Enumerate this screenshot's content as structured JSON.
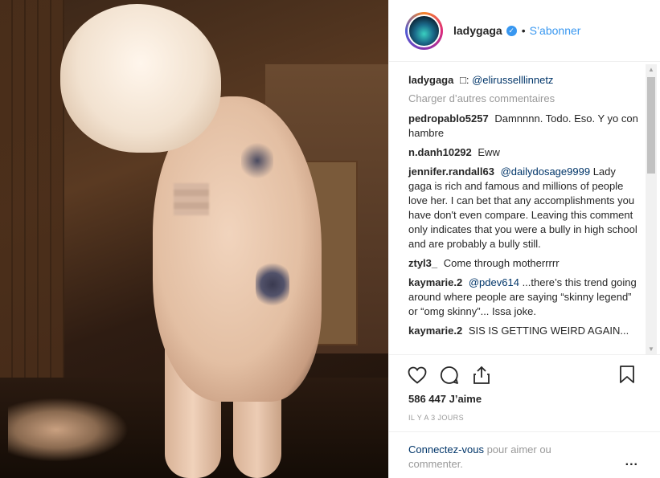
{
  "post": {
    "photo_alt": "photo",
    "owner": {
      "username": "ladygaga",
      "verified_icon": "verified-badge-icon",
      "separator": "•",
      "follow_label": "S’abonner"
    },
    "caption": {
      "user": "ladygaga",
      "symbol": "□:",
      "mention": "@elirusselllinnetz"
    },
    "load_more_label": "Charger d’autres commentaires",
    "comments": [
      {
        "user": "pedropablo5257",
        "mention": "",
        "text": "Damnnnn. Todo. Eso. Y yo con hambre"
      },
      {
        "user": "n.danh10292",
        "mention": "",
        "text": "Eww"
      },
      {
        "user": "jennifer.randall63",
        "mention": "@dailydosage9999",
        "text": "Lady gaga is rich and famous and millions of people love her. I can bet that any accomplishments you have don't even compare. Leaving this comment only indicates that you were a bully in high school and are probably a bully still."
      },
      {
        "user": "ztyl3_",
        "mention": "",
        "text": "Come through motherrrrr"
      },
      {
        "user": "kaymarie.2",
        "mention": "@pdev614",
        "text": "...there’s this trend going around where people are saying “skinny legend” or “omg skinny”... Issa joke."
      },
      {
        "user": "kaymarie.2",
        "mention": "",
        "text": "SIS IS GETTING WEIRD AGAIN..."
      }
    ],
    "actions": {
      "like_icon": "heart-icon",
      "comment_icon": "comment-icon",
      "share_icon": "share-icon",
      "save_icon": "bookmark-icon"
    },
    "likes_text": "586 447 J’aime",
    "timestamp": "IL Y A 3 JOURS",
    "login": {
      "link_label": "Connectez-vous",
      "rest_text": " pour aimer ou commenter.",
      "more_label": "..."
    },
    "scrollbar": {
      "up_arrow": "▲",
      "down_arrow": "▼"
    }
  }
}
